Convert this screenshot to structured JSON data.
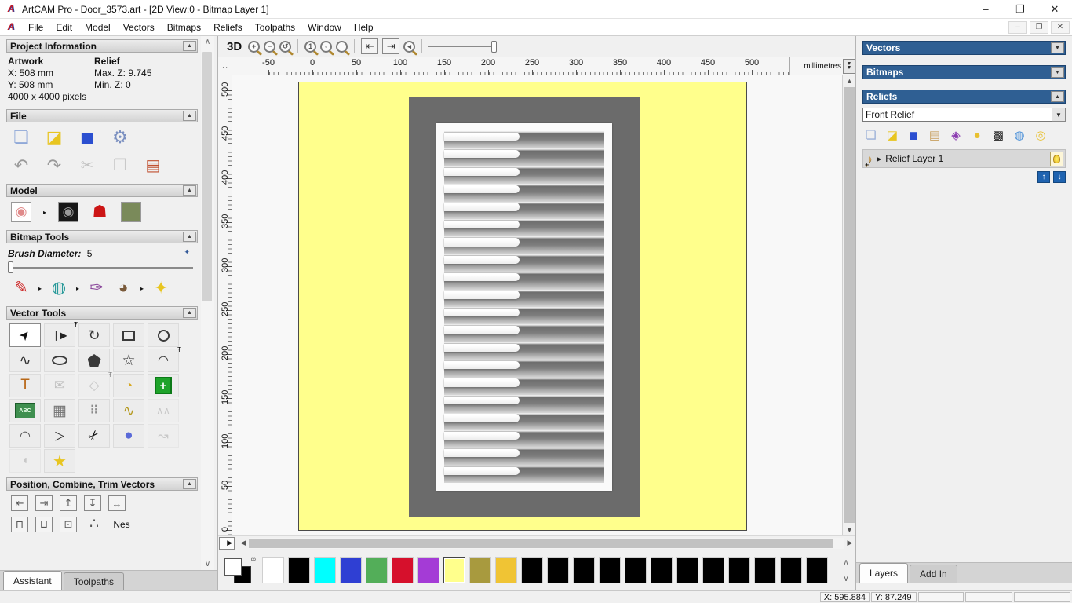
{
  "window": {
    "title": "ArtCAM Pro - Door_3573.art - [2D View:0 - Bitmap Layer 1]",
    "controls": {
      "minimize": "–",
      "restore": "❐",
      "close": "✕"
    }
  },
  "menu": {
    "items": [
      "File",
      "Edit",
      "Model",
      "Vectors",
      "Bitmaps",
      "Reliefs",
      "Toolpaths",
      "Window",
      "Help"
    ]
  },
  "mdi_controls": {
    "minimize": "–",
    "restore": "❐",
    "close": "✕"
  },
  "toolbar": {
    "buttons": [
      {
        "n": "view-3d-button",
        "label": "3D"
      },
      {
        "n": "zoom-in-icon",
        "t": "mag",
        "g": "+"
      },
      {
        "n": "zoom-out-icon",
        "t": "mag",
        "g": "−"
      },
      {
        "n": "zoom-previous-icon",
        "t": "mag",
        "g": "↺"
      },
      {
        "sep": true
      },
      {
        "n": "zoom-1to1-icon",
        "t": "mag",
        "g": "1"
      },
      {
        "n": "zoom-objects-icon",
        "t": "mag",
        "g": "▫"
      },
      {
        "n": "zoom-limits-icon",
        "t": "mag",
        "g": "",
        "dis": true
      },
      {
        "sep": true
      },
      {
        "n": "previous-vector-button",
        "g": "⇤",
        "box": true
      },
      {
        "n": "next-vector-button",
        "g": "⇥",
        "box": true
      },
      {
        "n": "zoom-back-icon",
        "t": "mag",
        "g": "◂",
        "dis": true
      },
      {
        "sep": true
      },
      {
        "n": "toolbar-slider",
        "slider": true,
        "track": 80
      }
    ]
  },
  "assistant": {
    "project_info": {
      "title": "Project Information",
      "artwork_label": "Artwork",
      "relief_label": "Relief",
      "x": "X: 508 mm",
      "y": "Y: 508 mm",
      "pixels": "4000 x 4000 pixels",
      "max_z": "Max. Z: 9.745",
      "min_z": "Min. Z: 0"
    },
    "file": {
      "title": "File",
      "icons_row1": [
        {
          "n": "new-model-icon",
          "g": "❏",
          "c": "#8fa8d8",
          "fs": 22
        },
        {
          "n": "open-model-icon",
          "g": "◪",
          "c": "#e8c520",
          "fs": 22
        },
        {
          "n": "save-model-icon",
          "g": "◼",
          "c": "#2b4fd0",
          "fs": 22
        },
        {
          "n": "model-properties-icon",
          "g": "⚙",
          "c": "#7a8fc0",
          "fs": 22
        }
      ],
      "icons_row2": [
        {
          "n": "undo-icon",
          "g": "↶",
          "c": "#9a9a9a",
          "fs": 22
        },
        {
          "n": "redo-icon",
          "g": "↷",
          "c": "#9a9a9a",
          "fs": 22
        },
        {
          "n": "cut-icon",
          "g": "✂",
          "c": "#8a8a8a",
          "dis": true,
          "fs": 20
        },
        {
          "n": "copy-icon",
          "g": "❐",
          "c": "#9a9a9a",
          "dis": true,
          "fs": 20
        },
        {
          "n": "paste-icon",
          "g": "▤",
          "c": "#c05030",
          "fs": 20
        }
      ]
    },
    "model": {
      "title": "Model",
      "icons": [
        {
          "n": "greyscale-from-model-icon",
          "t": "thumb",
          "g": "◉",
          "c": "#e08a8a",
          "bg": "#ffffff"
        },
        {
          "arrow": true
        },
        {
          "n": "invert-model-icon",
          "t": "thumb",
          "g": "◉",
          "c": "#9a9a9a",
          "bg": "#181818"
        },
        {
          "n": "lighting-lamp-icon",
          "g": "☗",
          "c": "#cc1515",
          "fs": 21
        },
        {
          "n": "relief-from-image-icon",
          "t": "thumb",
          "g": "",
          "c": "#444",
          "bg": "#7a8a5a"
        }
      ]
    },
    "bitmap_tools": {
      "title": "Bitmap Tools",
      "brush_label": "Brush Diameter:",
      "brush_value": "5",
      "icons": [
        {
          "n": "paint-brush-icon",
          "g": "✎",
          "c": "#cc2222",
          "fs": 21
        },
        {
          "arrow": true
        },
        {
          "n": "flood-fill-icon",
          "g": "◍",
          "c": "#2a9a9a",
          "fs": 21
        },
        {
          "arrow": true
        },
        {
          "n": "pick-colour-icon",
          "g": "✑",
          "c": "#884499",
          "fs": 21
        },
        {
          "n": "colour-palette-icon",
          "g": "◕",
          "c": "#7a5a3a",
          "fs": 21
        },
        {
          "arrow": true
        },
        {
          "n": "flood-replace-icon",
          "g": "✦",
          "c": "#e8c520",
          "fs": 22
        }
      ]
    },
    "vector_tools": {
      "title": "Vector Tools",
      "cells": [
        {
          "n": "select-vectors-icon",
          "g": "➤",
          "cls": "rot315",
          "c": "#111",
          "sel": true,
          "fs": 16
        },
        {
          "n": "node-editing-icon",
          "g": "❘▶",
          "c": "#222",
          "fs": 12,
          "pin": true
        },
        {
          "n": "transform-vectors-icon",
          "g": "↻",
          "c": "#333",
          "fs": 18
        },
        {
          "n": "create-rectangle-icon",
          "t": "rect"
        },
        {
          "n": "create-circle-icon",
          "t": "circ"
        },
        {
          "n": "create-freehand-icon",
          "g": "∿",
          "c": "#333",
          "fs": 18
        },
        {
          "n": "create-ellipse-icon",
          "t": "ell"
        },
        {
          "n": "create-polygon-icon",
          "t": "pent"
        },
        {
          "n": "create-star-icon",
          "g": "☆",
          "c": "#222",
          "fs": 19
        },
        {
          "n": "create-arc-icon",
          "g": "◠",
          "c": "#333",
          "fs": 16,
          "pin": true
        },
        {
          "n": "create-text-icon",
          "g": "T",
          "c": "#b86818",
          "fs": 19
        },
        {
          "n": "wrap-text-icon",
          "g": "✉",
          "c": "#888",
          "dis": true,
          "fs": 17
        },
        {
          "n": "measure-tool-icon",
          "g": "◇",
          "c": "#999",
          "dis": true,
          "fs": 17,
          "pin": true
        },
        {
          "n": "tape-measure-icon",
          "g": "◔",
          "c": "#d8a820",
          "fs": 18
        },
        {
          "n": "vector-doctor-icon",
          "t": "cross",
          "g": "+"
        },
        {
          "n": "text-block-icon",
          "t": "abc",
          "g": "ABC"
        },
        {
          "n": "envelope-distortion-icon",
          "g": "▦",
          "c": "#777",
          "fs": 19
        },
        {
          "n": "block-copy-icon",
          "g": "⠿",
          "c": "#8a8a8a",
          "fs": 16
        },
        {
          "n": "paste-along-curve-icon",
          "g": "∿",
          "c": "#b59a20",
          "fs": 18
        },
        {
          "n": "unwrap-vectors-icon",
          "g": "∧∧",
          "c": "#999",
          "dis": true,
          "fs": 12
        },
        {
          "n": "fit-arcs-icon",
          "g": "◠",
          "c": "#555",
          "fs": 16
        },
        {
          "n": "create-bisector-icon",
          "g": "＞",
          "c": "#333",
          "fs": 15
        },
        {
          "n": "trim-vectors-icon",
          "g": "✂",
          "c": "#111",
          "cls": "rot315",
          "fs": 17
        },
        {
          "n": "vector-dome-icon",
          "g": "●",
          "c": "#5a6ad8",
          "fs": 19
        },
        {
          "n": "fit-curve-icon",
          "g": "↝",
          "c": "#999",
          "dis": true,
          "fs": 16
        },
        {
          "n": "mirror-vectors-icon",
          "g": "◖",
          "c": "#999",
          "dis": true,
          "fs": 16
        },
        {
          "n": "vector-texture-icon",
          "g": "★",
          "c": "#e8c520",
          "fs": 20
        }
      ]
    },
    "position": {
      "title": "Position, Combine, Trim Vectors",
      "icons_row1": [
        {
          "n": "align-left-icon",
          "g": "⇤",
          "c": "#555",
          "box": true
        },
        {
          "n": "align-right-icon",
          "g": "⇥",
          "c": "#555",
          "box": true
        },
        {
          "n": "align-top-icon",
          "g": "↥",
          "c": "#555",
          "box": true
        },
        {
          "n": "align-bottom-icon",
          "g": "↧",
          "c": "#555",
          "box": true
        },
        {
          "n": "align-centre-icon",
          "g": "↔",
          "c": "#555",
          "box": true
        }
      ],
      "icons_row2": [
        {
          "n": "centre-in-page-v-icon",
          "g": "⊓",
          "c": "#555",
          "box": true
        },
        {
          "n": "centre-in-page-h-icon",
          "g": "⊔",
          "c": "#555",
          "box": true
        },
        {
          "n": "centre-in-page-icon",
          "g": "⊡",
          "c": "#555",
          "box": true,
          "pin": true
        },
        {
          "n": "spread-vectors-icon",
          "g": "∴",
          "c": "#555"
        },
        {
          "n": "nesting-icon",
          "g": "Nes",
          "c": "#111",
          "fs": 12
        }
      ]
    },
    "tabs": [
      {
        "label": "Assistant",
        "active": true
      },
      {
        "label": "Toolpaths",
        "active": false
      }
    ]
  },
  "ruler": {
    "units": "millimetres",
    "h_labels": [
      "-50",
      "0",
      "50",
      "100",
      "150",
      "200",
      "250",
      "300",
      "350",
      "400",
      "450",
      "500"
    ],
    "v_labels": [
      "500",
      "450",
      "400",
      "350",
      "300",
      "250",
      "200",
      "150",
      "100",
      "50",
      "0"
    ]
  },
  "canvas": {
    "louver_count": 20,
    "artwork_color": "#ffff8c",
    "door_color": "#6b6b6b",
    "frame_color": "#fafafa"
  },
  "palette": {
    "colors": [
      "#ffffff",
      "#000000",
      "#00ffff",
      "#2f3fd3",
      "#53ae59",
      "#d6102c",
      "#a43bd6",
      "#ffff8c",
      "#a89a3e",
      "#f0c434",
      "#000000",
      "#000000",
      "#000000",
      "#000000",
      "#000000",
      "#000000",
      "#000000",
      "#000000",
      "#000000",
      "#000000",
      "#000000",
      "#000000"
    ],
    "selected_index": 7,
    "primary": "#ffffff",
    "secondary": "#000000"
  },
  "right_panel": {
    "sections": [
      {
        "title": "Vectors",
        "arrow": "▼"
      },
      {
        "title": "Bitmaps",
        "arrow": "▼"
      },
      {
        "title": "Reliefs",
        "arrow": "▲"
      }
    ],
    "relief_dropdown_value": "Front Relief",
    "relief_icons": [
      {
        "n": "new-relief-layer-icon",
        "g": "❏",
        "c": "#9bb0d8"
      },
      {
        "n": "open-relief-icon",
        "g": "◪",
        "c": "#e8c520"
      },
      {
        "n": "save-relief-icon",
        "g": "◼",
        "c": "#2b4fd0"
      },
      {
        "n": "relief-clipart-icon",
        "g": "▤",
        "c": "#c8a060"
      },
      {
        "n": "relief-layer-stack-icon",
        "g": "◈",
        "c": "#8a3ab0"
      },
      {
        "n": "layer-visibility-icon",
        "g": "●",
        "c": "#e8c030"
      },
      {
        "n": "greyscale-preview-icon",
        "g": "▩",
        "c": "#222"
      },
      {
        "n": "delete-relief-icon",
        "g": "◍",
        "c": "#4a90d8"
      },
      {
        "n": "toggle-all-layers-icon",
        "g": "◎",
        "c": "#e8c030"
      }
    ],
    "layer": {
      "name": "Relief Layer 1"
    },
    "tabs": [
      {
        "label": "Layers",
        "active": true
      },
      {
        "label": "Add In",
        "active": false
      }
    ]
  },
  "status": {
    "x": "X: 595.884",
    "y": "Y: 87.249"
  }
}
